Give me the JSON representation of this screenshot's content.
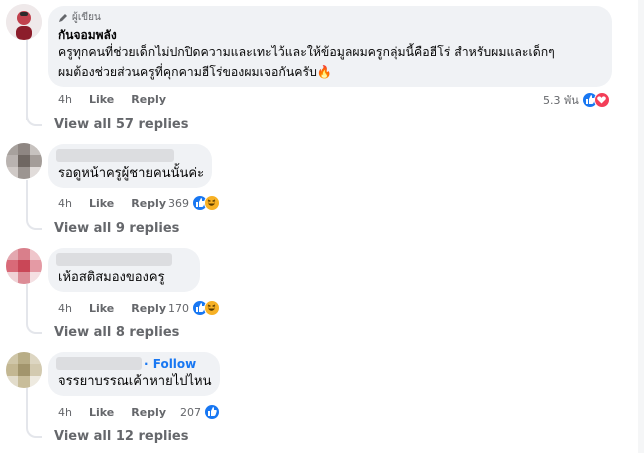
{
  "comments": [
    {
      "badge": "ผู้เขียน",
      "author": "กันจอมพลัง",
      "text_line1": "ครูทุกคนที่ช่วยเด็กไม่ปกปิดความและเทะไว้และให้ข้อมูลผมครูกลุ่มนี้คือฮีโร่ สำหรับผมและเด็กๆ",
      "text_line2": "ผมต้องช่วยส่วนครูที่คุกคามฮีโร่ของผมเจอกันครับ🔥",
      "time": "4h",
      "like": "Like",
      "reply": "Reply",
      "reaction_count": "5.3 พัน",
      "view_replies": "View all 57 replies"
    },
    {
      "text": "รอดูหน้าครูผู้ชายคนนั้นค่ะ",
      "time": "4h",
      "like": "Like",
      "reply": "Reply",
      "reaction_count": "369",
      "view_replies": "View all 9 replies"
    },
    {
      "text": "เห้อสติสมองของครู",
      "time": "4h",
      "like": "Like",
      "reply": "Reply",
      "reaction_count": "170",
      "view_replies": "View all 8 replies"
    },
    {
      "follow": "· Follow",
      "text": "จรรยาบรรณเค้าหายไปไหน",
      "time": "4h",
      "like": "Like",
      "reply": "Reply",
      "reaction_count": "207",
      "view_replies": "View all 12 replies"
    }
  ],
  "colors": {
    "link_blue": "#1877f2",
    "like_blue": "#1877f2",
    "heart_red": "#f33e58",
    "haha_yellow": "#f7b125"
  }
}
